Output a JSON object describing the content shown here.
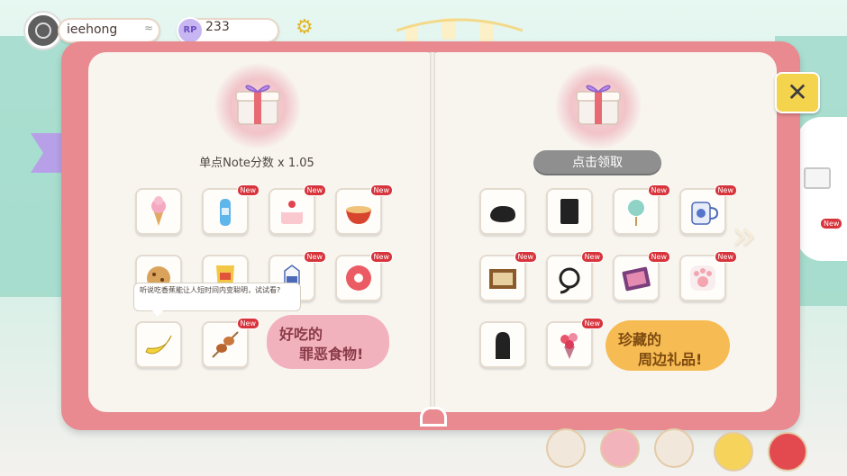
{
  "header": {
    "username": "ieehong",
    "rp_label": "RP",
    "rp_value": "233"
  },
  "left_page": {
    "reward_text": "单点Note分数 x 1.05",
    "sticker_line1": "好吃的",
    "sticker_line2": "罪恶食物!",
    "tooltip": "听说吃香蕉能让人短时间内变聪明，试试看?",
    "items": [
      {
        "name": "ice-cream-cone",
        "new": false
      },
      {
        "name": "ramune-bottle",
        "new": true
      },
      {
        "name": "strawberry-cake",
        "new": true
      },
      {
        "name": "ramen-bowl",
        "new": true
      },
      {
        "name": "cookie",
        "new": false
      },
      {
        "name": "chips-bag",
        "new": false
      },
      {
        "name": "milk-carton",
        "new": true
      },
      {
        "name": "donut",
        "new": true
      },
      {
        "name": "banana",
        "new": false
      },
      {
        "name": "grilled-skewer",
        "new": true
      }
    ]
  },
  "right_page": {
    "claim_label": "点击领取",
    "sticker_line1": "珍藏的",
    "sticker_line2": "周边礼品!",
    "items": [
      {
        "name": "locked-silhouette-cushion",
        "new": false
      },
      {
        "name": "locked-silhouette-card",
        "new": false
      },
      {
        "name": "fan-badge",
        "new": true
      },
      {
        "name": "character-mug",
        "new": true
      },
      {
        "name": "framed-picture",
        "new": true
      },
      {
        "name": "cable-headphones",
        "new": true
      },
      {
        "name": "art-book",
        "new": true
      },
      {
        "name": "cat-paw-pillow",
        "new": true
      },
      {
        "name": "locked-silhouette-plush",
        "new": false
      },
      {
        "name": "flower-bouquet",
        "new": true
      }
    ]
  },
  "badges": {
    "new_label": "New"
  },
  "icons": {
    "close": "close-icon",
    "settings": "gear-icon",
    "next": "double-chevron-right-icon"
  },
  "colors": {
    "book_cover": "#e88a8f",
    "page": "#f8f5ef",
    "new_badge": "#d7343c",
    "claim_button": "#8f8f8f",
    "close_button": "#f4d34d"
  }
}
